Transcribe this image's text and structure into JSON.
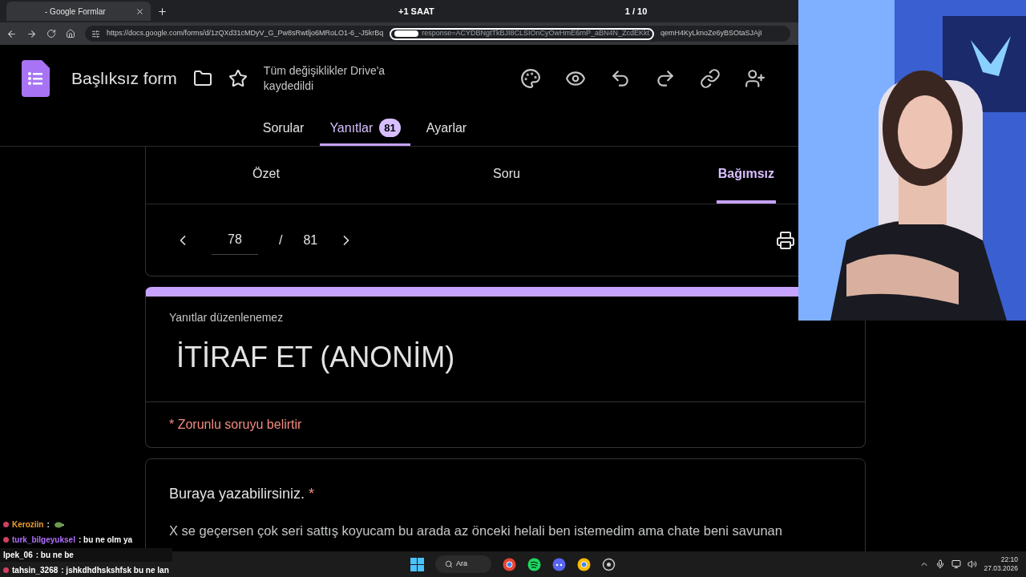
{
  "browser": {
    "tab_title": "- Google Formlar",
    "url_start": "https://docs.google.com/forms/d/1zQXd31cMDyV_G_Pw8sRwtljo6MRoLO1-6_-J5krBq",
    "url_end": "response=ACYDBNgtTkBJI8CLSIOnCyOwHmE6rnP_aBN4N_ZcdEKkt",
    "url_tail": "qemH4KyLknoZe6yBSOtaSJAjI"
  },
  "overlay": {
    "timer": "+1 SAAT",
    "counter": "1 / 10"
  },
  "form_header": {
    "title": "Başlıksız form",
    "save_status": "Tüm değişiklikler Drive'a kaydedildi"
  },
  "tabs": [
    {
      "label": "Sorular",
      "selected": false
    },
    {
      "label": "Yanıtlar",
      "selected": true,
      "badge": "81"
    },
    {
      "label": "Ayarlar",
      "selected": false
    }
  ],
  "subtabs": [
    {
      "label": "Özet",
      "selected": false
    },
    {
      "label": "Soru",
      "selected": false
    },
    {
      "label": "Bağımsız",
      "selected": true
    }
  ],
  "pager": {
    "current": "78",
    "separator": "/",
    "total": "81"
  },
  "response": {
    "note": "Yanıtlar düzenlenemez",
    "title": "İTİRAF ET (ANONİM)",
    "required_hint": "* Zorunlu soruyu belirtir",
    "question": "Buraya yazabilirsiniz.",
    "required_mark": "*",
    "answer": "X se geçersen çok seri  sattış koyucam bu arada az önceki helali ben istemedim ama chate beni savunan"
  },
  "chat": [
    {
      "user": "Keroziin",
      "message": ":",
      "color": "#f0a030",
      "emote": true,
      "moon": true
    },
    {
      "user": "turk_bilgeyuksel",
      "message": ": bu ne olm ya",
      "color": "#b070ff",
      "emote": false,
      "moon": true
    },
    {
      "user": "Ipek_06",
      "message": ": bu ne be",
      "color": "#ffffff",
      "emote": false,
      "moon": false
    },
    {
      "user": "tahsin_3268",
      "message": ": jshkdhdhskshfsk bu ne lan",
      "color": "#ffffff",
      "emote": false,
      "moon": true
    }
  ],
  "taskbar": {
    "search": "Ara",
    "time": "22:10",
    "date": "27.03.2026"
  }
}
